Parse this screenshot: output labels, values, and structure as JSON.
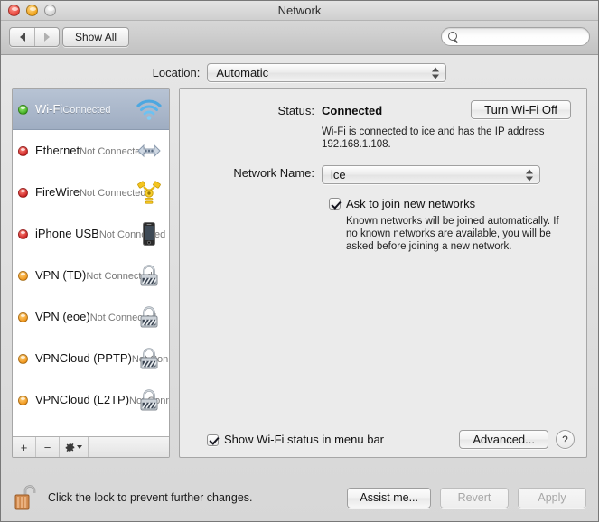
{
  "window": {
    "title": "Network",
    "traffic_lights": [
      "close",
      "minimize",
      "zoom"
    ]
  },
  "toolbar": {
    "back_icon": "arrow-left-icon",
    "forward_icon": "arrow-right-icon",
    "show_all_label": "Show All",
    "search_placeholder": "",
    "search_value": "",
    "search_icon": "search-icon"
  },
  "location": {
    "label": "Location:",
    "selected": "Automatic",
    "options": [
      "Automatic"
    ]
  },
  "sidebar": {
    "items": [
      {
        "name": "Wi-Fi",
        "status": "Connected",
        "dot": "green",
        "icon": "wifi-icon",
        "selected": true
      },
      {
        "name": "Ethernet",
        "status": "Not Connected",
        "dot": "red",
        "icon": "ethernet-icon",
        "selected": false
      },
      {
        "name": "FireWire",
        "status": "Not Connected",
        "dot": "red",
        "icon": "firewire-icon",
        "selected": false
      },
      {
        "name": "iPhone USB",
        "status": "Not Connected",
        "dot": "red",
        "icon": "iphone-icon",
        "selected": false
      },
      {
        "name": "VPN (TD)",
        "status": "Not Connected",
        "dot": "orange",
        "icon": "lock-icon",
        "selected": false
      },
      {
        "name": "VPN (eoe)",
        "status": "Not Connected",
        "dot": "orange",
        "icon": "lock-icon",
        "selected": false
      },
      {
        "name": "VPNCloud (PPTP)",
        "status": "Not Connected",
        "dot": "orange",
        "icon": "lock-icon",
        "selected": false
      },
      {
        "name": "VPNCloud (L2TP)",
        "status": "Not Connected",
        "dot": "orange",
        "icon": "lock-icon",
        "selected": false
      }
    ],
    "toolbar": {
      "add_label": "+",
      "remove_label": "−",
      "action_icon": "gear-icon"
    }
  },
  "panel": {
    "status_label": "Status:",
    "status_value": "Connected",
    "turn_off_label": "Turn Wi-Fi Off",
    "status_description": "Wi-Fi is connected to ice and has the IP address 192.168.1.108.",
    "network_name_label": "Network Name:",
    "network_name_value": "ice",
    "ask_join_label": "Ask to join new networks",
    "ask_join_checked": true,
    "ask_join_description": "Known networks will be joined automatically. If no known networks are available, you will be asked before joining a new network.",
    "show_status_label": "Show Wi-Fi status in menu bar",
    "show_status_checked": true,
    "advanced_label": "Advanced...",
    "help_label": "?"
  },
  "footer": {
    "lock_icon": "unlocked-padlock-icon",
    "lock_text": "Click the lock to prevent further changes.",
    "assist_label": "Assist me...",
    "revert_label": "Revert",
    "apply_label": "Apply",
    "revert_enabled": false,
    "apply_enabled": false
  },
  "colors": {
    "selection": "#9fadc2",
    "connected_dot": "#3eab1f",
    "disconnected_dot": "#cc2020",
    "inactive_dot": "#f0951a"
  }
}
